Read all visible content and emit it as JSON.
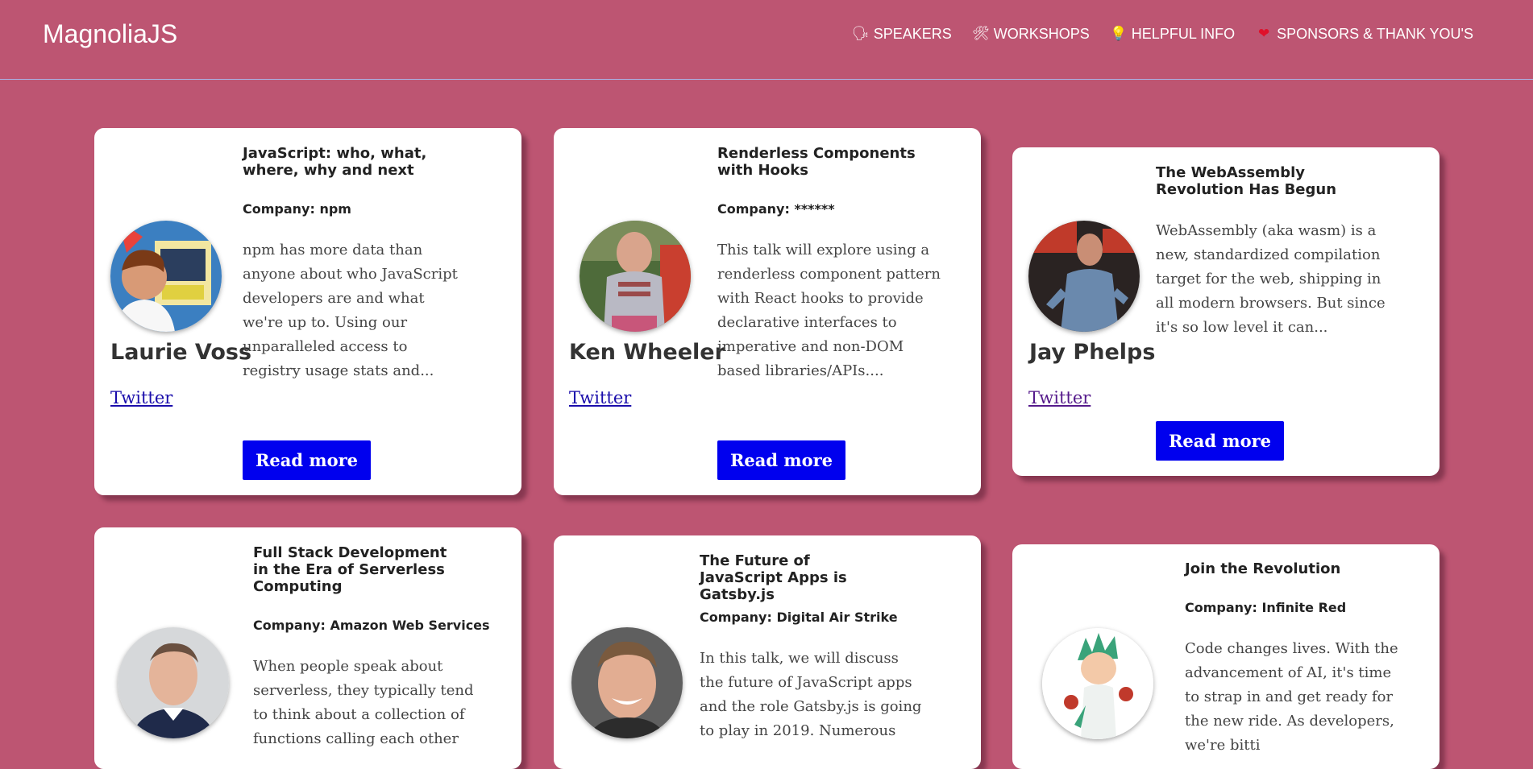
{
  "site": {
    "brand": "MagnoliaJS"
  },
  "nav": [
    {
      "icon": "speaker-icon",
      "glyph": "🗣",
      "label": "SPEAKERS"
    },
    {
      "icon": "tools-icon",
      "glyph": "🛠",
      "label": "WORKSHOPS"
    },
    {
      "icon": "lightbulb-icon",
      "glyph": "💡",
      "label": "HELPFUL INFO"
    },
    {
      "icon": "heart-icon",
      "glyph": "❤",
      "label": "SPONSORS & THANK YOU'S"
    }
  ],
  "speakers": [
    {
      "name": "Laurie Voss",
      "title": "JavaScript: who, what, where, why and next",
      "company": "Company: npm",
      "description": "npm has more data than anyone about who JavaScript developers are and what we're up to. Using our unparalleled access to registry usage stats and...",
      "twitter": "Twitter",
      "read_more": "Read more"
    },
    {
      "name": "Ken Wheeler",
      "title": "Renderless Components with Hooks",
      "company": "Company: ******",
      "description": "This talk will explore using a renderless component pattern with React hooks to provide declarative interfaces to imperative and non-DOM based libraries/APIs....",
      "twitter": "Twitter",
      "read_more": "Read more"
    },
    {
      "name": "Jay Phelps",
      "title": "The WebAssembly Revolution Has Begun",
      "company": "",
      "description": "WebAssembly (aka wasm) is a new, standardized compilation target for the web, shipping in all modern browsers. But since it's so low level it can...",
      "twitter": "Twitter",
      "read_more": "Read more"
    },
    {
      "name": "",
      "title": "Full Stack Development in the Era of Serverless Computing",
      "company": "Company: Amazon Web Services",
      "description": "When people speak about serverless, they typically tend to think about a collection of functions calling each other",
      "twitter": "",
      "read_more": ""
    },
    {
      "name": "",
      "title": "The Future of JavaScript Apps is Gatsby.js",
      "company": "Company: Digital Air Strike",
      "description": "In this talk, we will discuss the future of JavaScript apps and the role Gatsby.js is going to play in 2019. Numerous",
      "twitter": "",
      "read_more": ""
    },
    {
      "name": "",
      "title": "Join the Revolution",
      "company": "Company: Infinite Red",
      "description": "Code changes lives. With the advancement of AI, it's time to strap in and get ready for the new ride. As developers, we're bitti",
      "twitter": "",
      "read_more": ""
    }
  ]
}
